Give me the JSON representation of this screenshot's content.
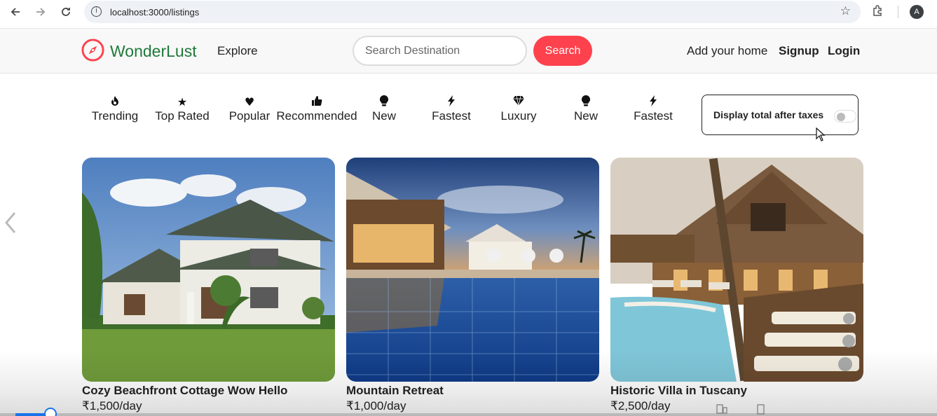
{
  "browser": {
    "url": "localhost:3000/listings",
    "profile_initial": "A"
  },
  "navbar": {
    "brand": "WonderLust",
    "explore": "Explore",
    "search_placeholder": "Search Destination",
    "search_button": "Search",
    "add_home": "Add your home",
    "signup": "Signup",
    "login": "Login",
    "accent_color": "#fe424d",
    "brand_color": "#1f7a3a"
  },
  "filters": [
    {
      "label": "Trending",
      "icon": "fire-icon"
    },
    {
      "label": "Top Rated",
      "icon": "star-icon"
    },
    {
      "label": "Popular",
      "icon": "heart-icon"
    },
    {
      "label": "Recommended",
      "icon": "thumbs-up-icon"
    },
    {
      "label": "New",
      "icon": "lightbulb-icon"
    },
    {
      "label": "Fastest",
      "icon": "bolt-icon"
    },
    {
      "label": "Luxury",
      "icon": "gem-icon"
    },
    {
      "label": "New",
      "icon": "lightbulb-icon"
    },
    {
      "label": "Fastest",
      "icon": "bolt-icon"
    }
  ],
  "tax_toggle": {
    "label": "Display total after taxes",
    "enabled": false
  },
  "listings": [
    {
      "title": "Cozy Beachfront Cottage Wow Hello",
      "price": "₹1,500/day",
      "image": "white two-storey house on green lawn"
    },
    {
      "title": "Mountain Retreat",
      "price": "₹1,000/day",
      "image": "resort pool at dusk"
    },
    {
      "title": "Historic Villa in Tuscany",
      "price": "₹2,500/day",
      "image": "wooden lodge with pool and loungers"
    }
  ],
  "video_progress": 0.04
}
